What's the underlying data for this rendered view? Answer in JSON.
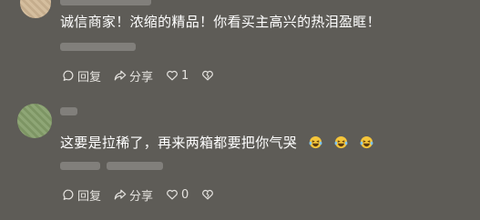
{
  "comments": [
    {
      "text": "诚信商家！浓缩的精品！你看买主高兴的热泪盈眶！",
      "reply_label": "回复",
      "share_label": "分享",
      "like_count": "1"
    },
    {
      "text": "这要是拉稀了，再来两箱都要把你气哭",
      "emojis": [
        "laughing-tears",
        "laughing-tears",
        "laughing-tears"
      ],
      "reply_label": "回复",
      "share_label": "分享",
      "like_count": "0"
    }
  ],
  "colors": {
    "background": "#5e5c57",
    "text": "#ffffff",
    "emoji": "#f5c53a"
  }
}
